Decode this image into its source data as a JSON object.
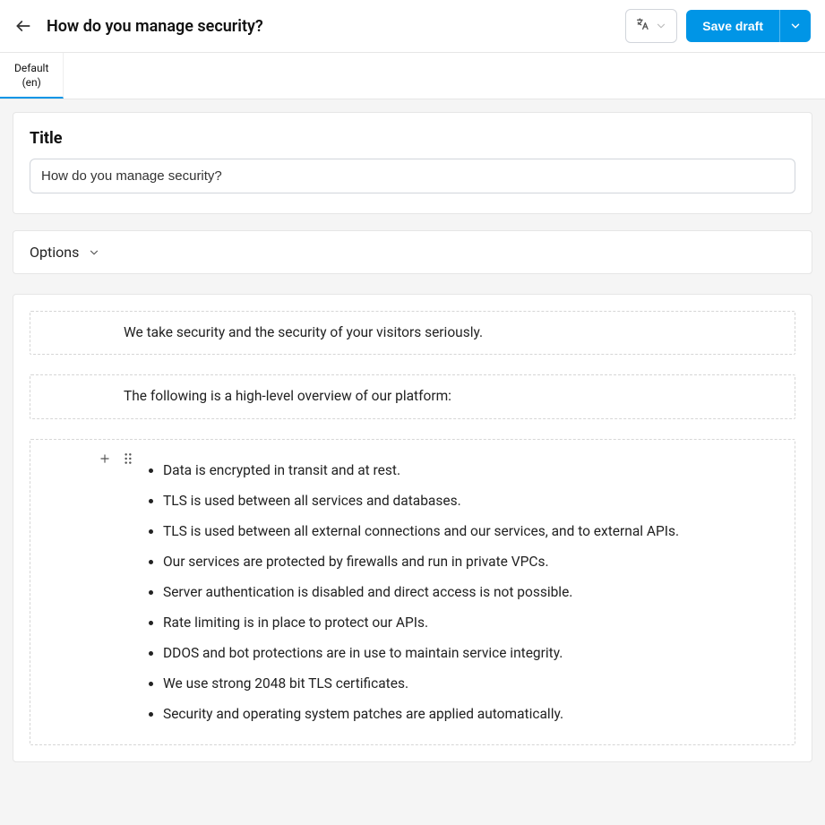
{
  "header": {
    "title": "How do you manage security?",
    "save_label": "Save draft"
  },
  "tabs": {
    "default_label": "Default",
    "default_sub": "(en)"
  },
  "title_section": {
    "label": "Title",
    "value": "How do you manage security?"
  },
  "options": {
    "label": "Options"
  },
  "editor": {
    "para1": "We take security and the security of your visitors seriously.",
    "para2": "The following is a high-level overview of our platform:",
    "bullets": [
      "Data is encrypted in transit and at rest.",
      "TLS is used between all services and databases.",
      "TLS is used between all external connections and our services, and to external APIs.",
      "Our services are protected by firewalls and run in private VPCs.",
      "Server authentication is disabled and direct access is not possible.",
      "Rate limiting is in place to protect our APIs.",
      "DDOS and bot protections are in use to maintain service integrity.",
      "We use strong 2048 bit TLS certificates.",
      "Security and operating system patches are applied automatically."
    ]
  }
}
